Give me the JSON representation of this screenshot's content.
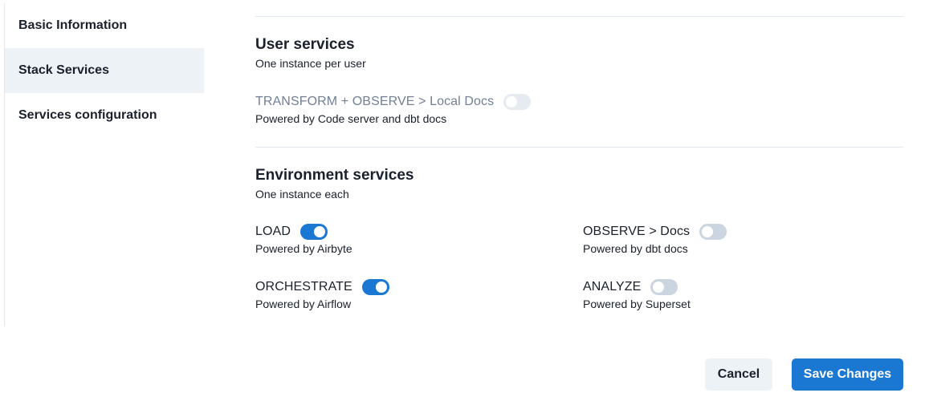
{
  "sidebar": {
    "items": [
      {
        "label": "Basic Information",
        "active": false
      },
      {
        "label": "Stack Services",
        "active": true
      },
      {
        "label": "Services configuration",
        "active": false
      }
    ]
  },
  "user_services": {
    "title": "User services",
    "subtitle": "One instance per user",
    "services": [
      {
        "label": "TRANSFORM + OBSERVE > Local Docs",
        "description": "Powered by Code server and dbt docs",
        "enabled": false,
        "disabled": true
      }
    ]
  },
  "environment_services": {
    "title": "Environment services",
    "subtitle": "One instance each",
    "services": [
      {
        "label": "LOAD",
        "description": "Powered by Airbyte",
        "enabled": true
      },
      {
        "label": "OBSERVE > Docs",
        "description": "Powered by dbt docs",
        "enabled": false
      },
      {
        "label": "ORCHESTRATE",
        "description": "Powered by Airflow",
        "enabled": true
      },
      {
        "label": "ANALYZE",
        "description": "Powered by Superset",
        "enabled": false
      }
    ]
  },
  "footer": {
    "cancel_label": "Cancel",
    "save_label": "Save Changes"
  },
  "colors": {
    "accent": "#1a77d2",
    "active_bg": "#edf2f7"
  }
}
